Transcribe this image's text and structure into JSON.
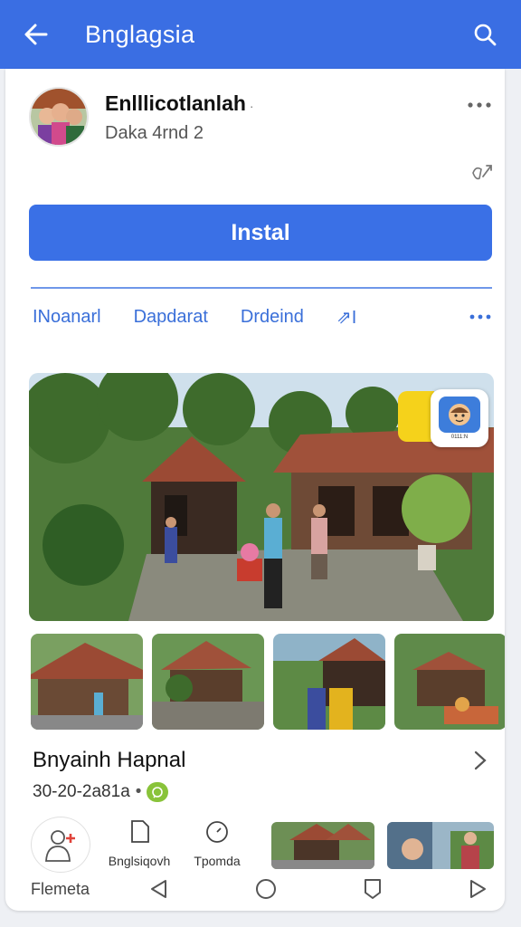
{
  "appbar": {
    "title": "Bnglagsia",
    "back_icon": "arrow-left-icon",
    "search_icon": "search-icon",
    "bg": "#3a6ee3"
  },
  "app": {
    "name": "Enlllicotlanlah",
    "name_suffix": "·",
    "subtitle": "Daka 4rnd 2",
    "install_label": "Instal"
  },
  "tabs": [
    "INoanarl",
    "Dapdarat",
    "Drdeind",
    "⇗I"
  ],
  "hero": {
    "badge_caption": "0111:N"
  },
  "section": {
    "title": "Bnyainh Hapnal",
    "meta_date": "30-20-2a81a",
    "meta_dot": "•"
  },
  "actions": [
    {
      "label": "Bnglsiqovh"
    },
    {
      "label": "Tpomda"
    }
  ],
  "bottom_nav": {
    "label": "Flemeta"
  },
  "colors": {
    "accent": "#3a70e6",
    "tab_text": "#3a6fd9",
    "badge_green": "#89c33a",
    "badge_yellow": "#f5d21b"
  }
}
